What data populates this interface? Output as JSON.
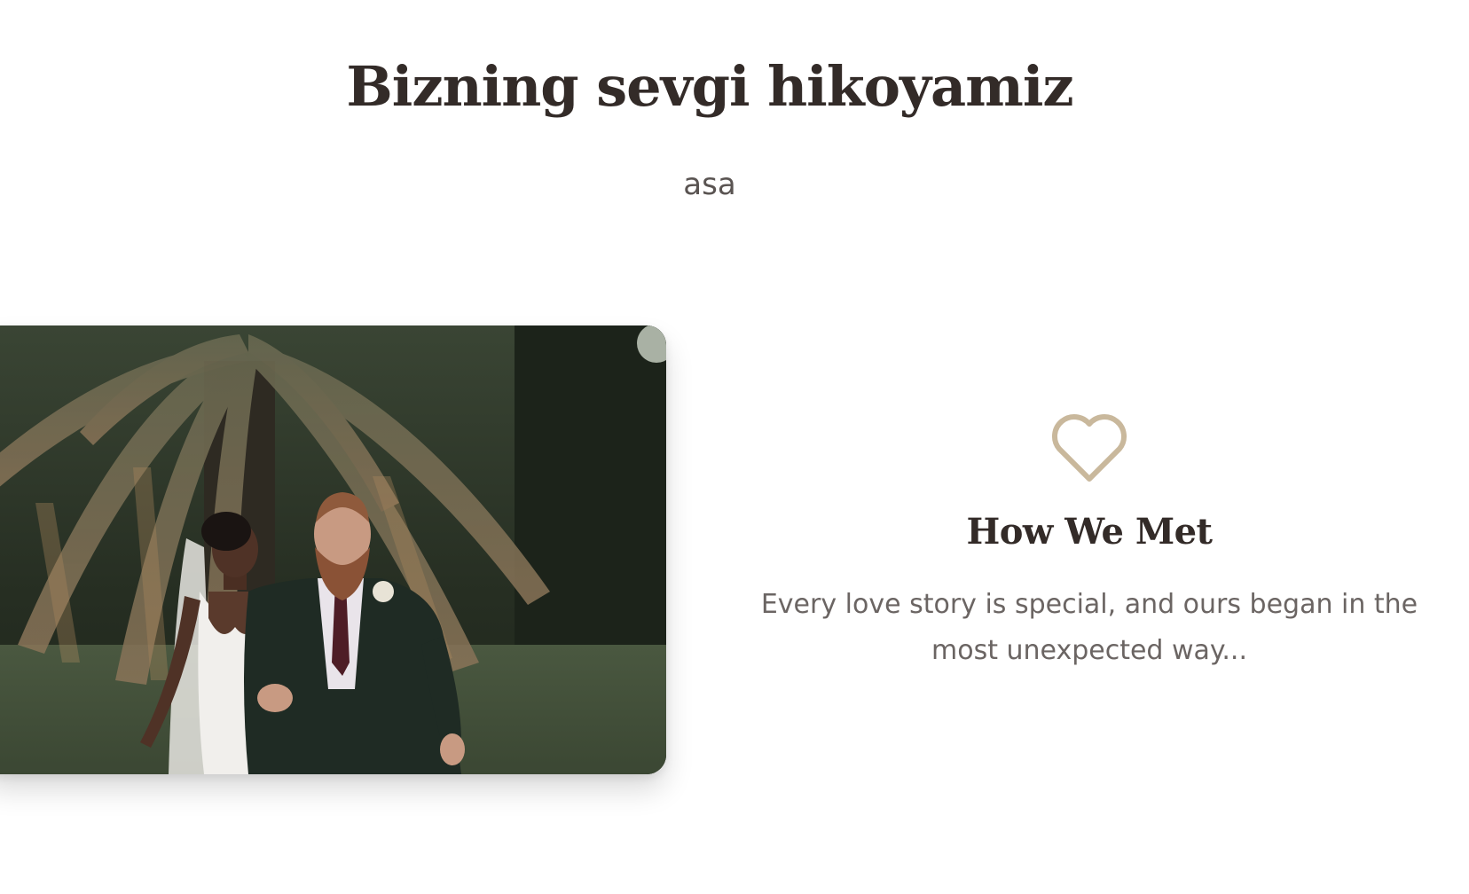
{
  "section": {
    "title": "Bizning sevgi hikoyamiz",
    "subtitle": "asa"
  },
  "story": {
    "photo_description": "couple-photo",
    "icon": "heart-outline-icon",
    "icon_color": "#c9b89c",
    "heading": "How We Met",
    "body": "Every love story is special, and ours began in the most unexpected way..."
  },
  "colors": {
    "heading": "#332b28",
    "subtitle": "#5a5452",
    "body": "#6b6563",
    "accent": "#c9b89c"
  }
}
